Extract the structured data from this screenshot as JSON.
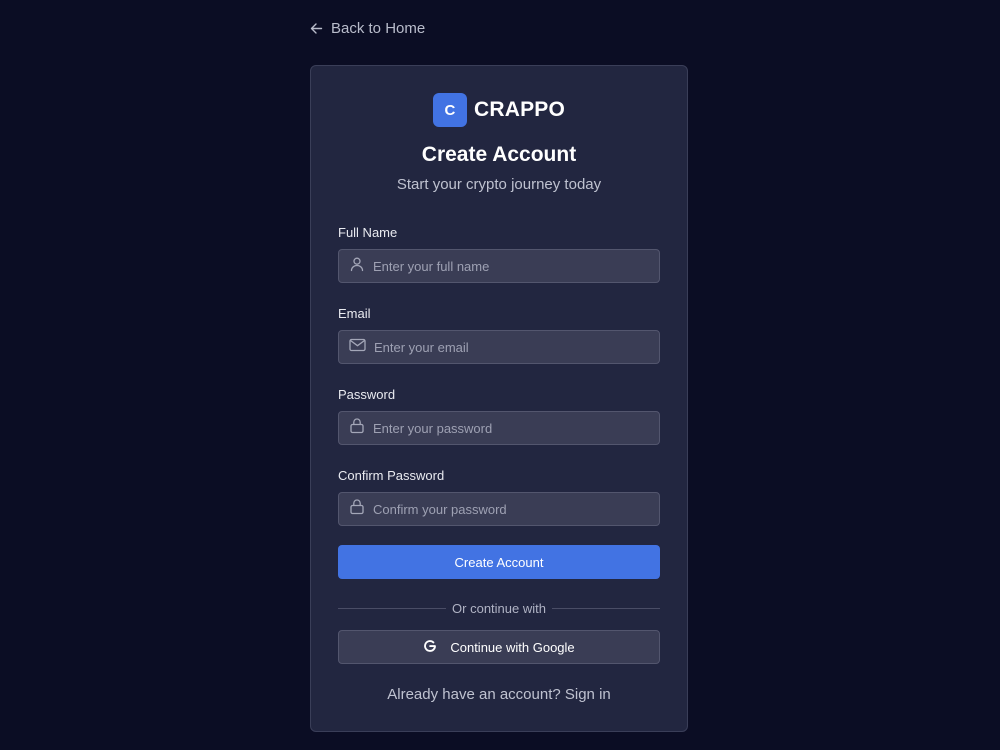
{
  "nav": {
    "back_label": "Back to Home"
  },
  "brand": {
    "logo_letter": "C",
    "name": "CRAPPO",
    "accent_color": "#4273e3"
  },
  "header": {
    "title": "Create Account",
    "subtitle": "Start your crypto journey today"
  },
  "form": {
    "full_name": {
      "label": "Full Name",
      "placeholder": "Enter your full name",
      "value": "",
      "icon": "user-icon"
    },
    "email": {
      "label": "Email",
      "placeholder": "Enter your email",
      "value": "",
      "icon": "mail-icon"
    },
    "password": {
      "label": "Password",
      "placeholder": "Enter your password",
      "value": "",
      "icon": "lock-icon"
    },
    "confirm_password": {
      "label": "Confirm Password",
      "placeholder": "Confirm your password",
      "value": "",
      "icon": "lock-icon"
    },
    "submit_label": "Create Account"
  },
  "divider_text": "Or continue with",
  "google": {
    "label": "Continue with Google",
    "icon": "google-icon"
  },
  "footer": {
    "prompt": "Already have an account?",
    "link_label": "Sign in"
  },
  "colors": {
    "background": "#0b0d24",
    "card": "#222640",
    "input": "#3a3d55",
    "primary": "#4273e3"
  }
}
